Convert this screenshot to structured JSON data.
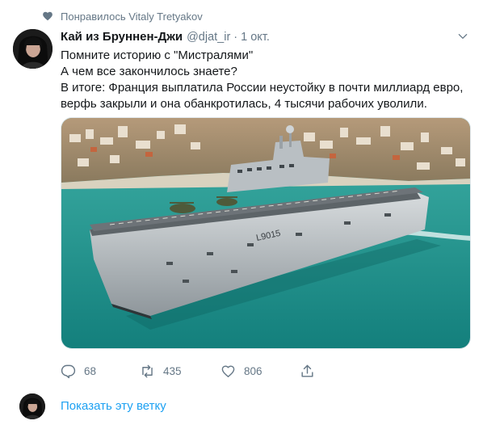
{
  "social_context": {
    "icon": "heart-icon",
    "text": "Понравилось Vitaly Tretyakov"
  },
  "tweet": {
    "author_name": "Кай из Бруннен-Джи",
    "handle": "@djat_ir",
    "separator": "·",
    "date": "1 окт.",
    "text_lines": [
      "Помните историю с \"Мистралями\"",
      "А чем все закончилось знаете?",
      "В итоге: Франция выплатила России неустойку в почти миллиард евро,",
      "верфь закрыли и она обанкротилась, 4 тысячи рабочих уволили."
    ],
    "media": {
      "ship_hull_number": "L9015"
    },
    "actions": {
      "reply_count": "68",
      "retweet_count": "435",
      "like_count": "806"
    }
  },
  "thread": {
    "show_thread_label": "Показать эту ветку"
  },
  "colors": {
    "link": "#1da1f2",
    "secondary_text": "#657786",
    "primary_text": "#14171a",
    "sea": "#1f9a94"
  }
}
